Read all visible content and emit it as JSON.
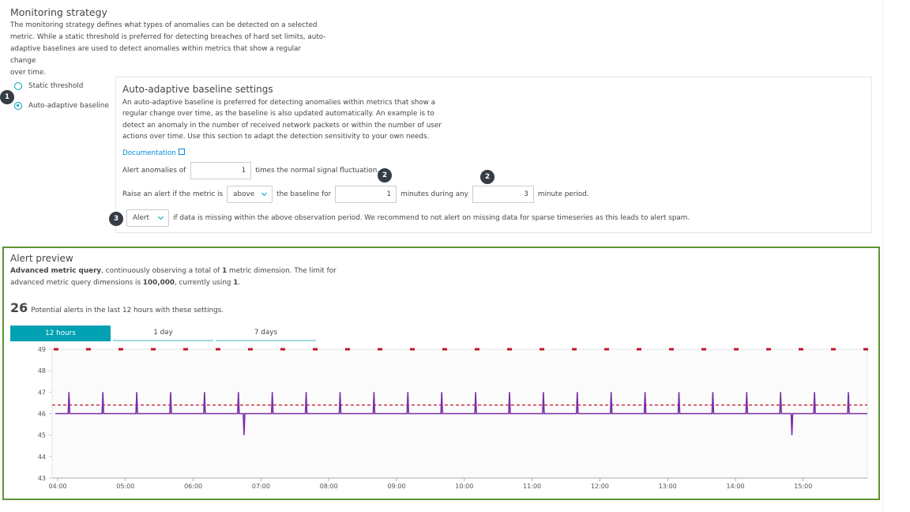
{
  "monitoring": {
    "title": "Monitoring strategy",
    "description_lines": [
      "The monitoring strategy defines what types of anomalies can be detected on a selected",
      "metric. While a static threshold is preferred for detecting breaches of hard set limits, auto-",
      "adaptive baselines are used to detect anomalies within metrics that show a regular change",
      "over time."
    ],
    "options": [
      {
        "label": "Static threshold",
        "selected": false
      },
      {
        "label": "Auto-adaptive baseline",
        "selected": true
      }
    ]
  },
  "markers": {
    "one": "1",
    "two": "2",
    "three": "3"
  },
  "settings": {
    "title": "Auto-adaptive baseline settings",
    "description_lines": [
      "An auto-adaptive baseline is preferred for detecting anomalies within metrics that show a",
      "regular change over time, as the baseline is also updated automatically. An example is to",
      "detect an anomaly in the number of received network packets or within the number of user",
      "actions over time. Use this section to adapt the detection sensitivity to your own needs."
    ],
    "doc_link": "Documentation",
    "row1": {
      "prefix": "Alert anomalies of",
      "value": "1",
      "suffix": "times the normal signal fluctuation."
    },
    "row2": {
      "prefix": "Raise an alert if the metric is",
      "direction": "above",
      "mid": "the baseline for",
      "minutes": "1",
      "mid2": "minutes during any",
      "period": "3",
      "suffix": "minute period."
    },
    "row3": {
      "action": "Alert",
      "text": "if data is missing within the above observation period. We recommend to not alert on missing data for sparse timeseries as this leads to alert spam."
    }
  },
  "preview": {
    "title": "Alert preview",
    "line1_bold": "Advanced metric query",
    "line1_a": ", continuously observing a total of ",
    "line1_b": "1",
    "line1_c": " metric dimension. The limit for",
    "line2_a": "advanced metric query dimensions is ",
    "line2_b": "100,000",
    "line2_c": ", currently using ",
    "line2_d": "1",
    "line2_e": ".",
    "count": "26",
    "count_text": "Potential alerts in the last 12 hours with these settings.",
    "tabs": [
      {
        "label": "12 hours",
        "active": true
      },
      {
        "label": "1 day",
        "active": false
      },
      {
        "label": "7 days",
        "active": false
      }
    ]
  },
  "chart_data": {
    "type": "line",
    "x_ticks": [
      "04:00",
      "05:00",
      "06:00",
      "07:00",
      "08:00",
      "09:00",
      "10:00",
      "11:00",
      "12:00",
      "13:00",
      "14:00",
      "15:00"
    ],
    "y_ticks": [
      43,
      44,
      45,
      46,
      47,
      48,
      49
    ],
    "ylim": [
      43,
      49
    ],
    "series": [
      {
        "role": "metric",
        "color": "#7b2fa8",
        "baseline": 46,
        "spikes_up_at": [
          "04:10",
          "05:10",
          "06:10",
          "07:10",
          "08:10",
          "09:10",
          "10:10",
          "11:10",
          "12:10",
          "13:10",
          "14:10",
          "15:10"
        ],
        "all_up_spikes_x": [
          "04:10",
          "04:40",
          "05:10",
          "05:40",
          "06:10",
          "06:40",
          "07:10",
          "07:40",
          "08:10",
          "08:40",
          "09:10",
          "09:40",
          "10:10",
          "10:40",
          "11:10",
          "11:40",
          "12:10",
          "12:40",
          "13:10",
          "13:40",
          "14:10",
          "14:40",
          "15:10",
          "15:40"
        ],
        "spike_value": 47,
        "dips_at": [
          "06:45",
          "14:50"
        ],
        "dip_value": 45
      },
      {
        "role": "baseline-threshold",
        "color": "#c41425",
        "style": "dashed",
        "value": 46.4
      },
      {
        "role": "alert-markers",
        "color": "#c41425",
        "y": 49,
        "count": 26
      }
    ]
  }
}
